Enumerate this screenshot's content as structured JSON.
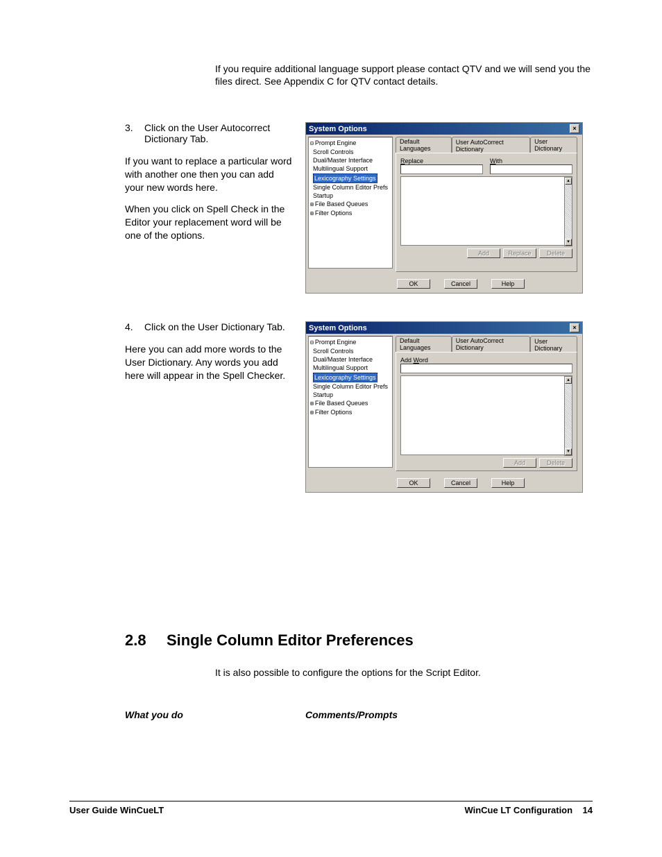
{
  "intro": "If you require additional language support please contact QTV and  we will send you the files direct. See Appendix C for QTV contact details.",
  "step3": {
    "num": "3.",
    "title": "Click on the User Autocorrect Dictionary Tab.",
    "p1": "If you want to replace a particular word with another one then you can add your new words here.",
    "p2": "When you click on Spell Check in the Editor your replacement word will be one of the options."
  },
  "step4": {
    "num": "4.",
    "title": "Click on the User Dictionary Tab.",
    "p1": "Here you can add more words to the User Dictionary. Any words you add here will appear in the Spell Checker."
  },
  "dialog": {
    "title": "System Options",
    "tree": {
      "t0": "Prompt Engine",
      "t1": "Scroll Controls",
      "t2": "Dual/Master Interface",
      "t3": "Multilingual Support",
      "t4": "Lexicography Settings",
      "t5": "Single Column Editor Prefs",
      "t6": "Startup",
      "t7": "File Based Queues",
      "t8": "Filter Options"
    },
    "tabs": {
      "a": "Default Languages",
      "b": "User AutoCorrect Dictionary",
      "c": "User Dictionary"
    },
    "labels": {
      "replace": "Replace",
      "with": "With",
      "addword": "Add Word"
    },
    "buttons": {
      "add": "Add",
      "replace": "Replace",
      "delete": "Delete",
      "ok": "OK",
      "cancel": "Cancel",
      "help": "Help"
    }
  },
  "section28": {
    "num": "2.8",
    "title": "Single Column Editor Preferences",
    "intro": "It is also possible to configure the options for the Script Editor.",
    "colA": "What you do",
    "colB": "Comments/Prompts"
  },
  "footer": {
    "left": "User Guide WinCueLT",
    "right_a": "WinCue LT Configuration",
    "right_b": "14"
  }
}
